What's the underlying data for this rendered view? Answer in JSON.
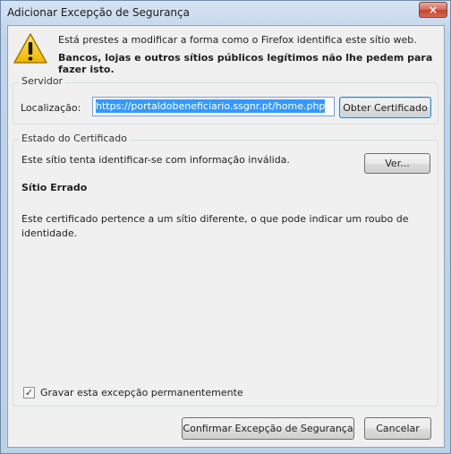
{
  "window": {
    "title": "Adicionar Excepção de Segurança",
    "close_label": "×"
  },
  "intro": {
    "line1": "Está prestes a modificar a forma como o Firefox identifica este sítio web.",
    "line2": "Bancos, lojas e outros sítios públicos legítimos não lhe pedem para fazer isto.",
    "icon": "warning-icon"
  },
  "server": {
    "group_label": "Servidor",
    "location_label": "Localização:",
    "location_value": "https://portaldobeneficiario.ssgnr.pt/home.php",
    "get_certificate_label": "Obter Certificado"
  },
  "certificate_status": {
    "group_label": "Estado do Certificado",
    "message": "Este sítio tenta identificar-se com informação inválida.",
    "view_label": "Ver...",
    "error_title": "Sítio Errado",
    "error_detail": "Este certificado pertence a um sítio diferente, o que pode indicar um roubo de identidade.",
    "remember_label": "Gravar esta excepção permanentemente",
    "remember_checked": true
  },
  "actions": {
    "confirm_label": "Confirmar Excepção de Segurança",
    "cancel_label": "Cancelar"
  },
  "colors": {
    "accent": "#3399ff",
    "warning": "#f5c400",
    "close_button": "#c1432f"
  }
}
